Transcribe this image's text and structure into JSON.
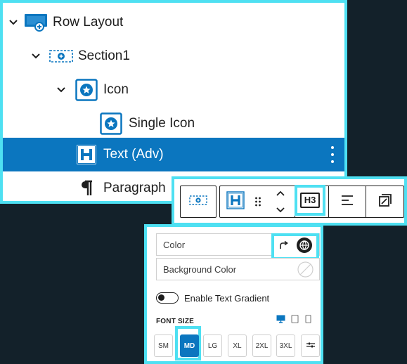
{
  "list_view": {
    "items": [
      {
        "label": "Row Layout",
        "icon": "row-layout-icon",
        "expanded": true
      },
      {
        "label": "Section1",
        "icon": "section-icon",
        "expanded": true
      },
      {
        "label": "Icon",
        "icon": "icon-block-icon",
        "expanded": true
      },
      {
        "label": "Single Icon",
        "icon": "single-icon-icon"
      },
      {
        "label": "Text (Adv)",
        "icon": "heading-h-icon",
        "selected": true
      },
      {
        "label": "Paragraph",
        "icon": "pilcrow-icon"
      }
    ]
  },
  "toolbar": {
    "heading_level": "H3"
  },
  "settings": {
    "color_label": "Color",
    "background_color_label": "Background Color",
    "gradient_toggle_label": "Enable Text Gradient",
    "gradient_enabled": false,
    "font_size_heading": "FONT SIZE",
    "font_sizes": [
      "SM",
      "MD",
      "LG",
      "XL",
      "2XL",
      "3XL"
    ],
    "font_size_selected": "MD"
  },
  "colors": {
    "accent_blue": "#0b76bf",
    "highlight_cyan": "#4ee0f2",
    "background": "#13212a"
  }
}
